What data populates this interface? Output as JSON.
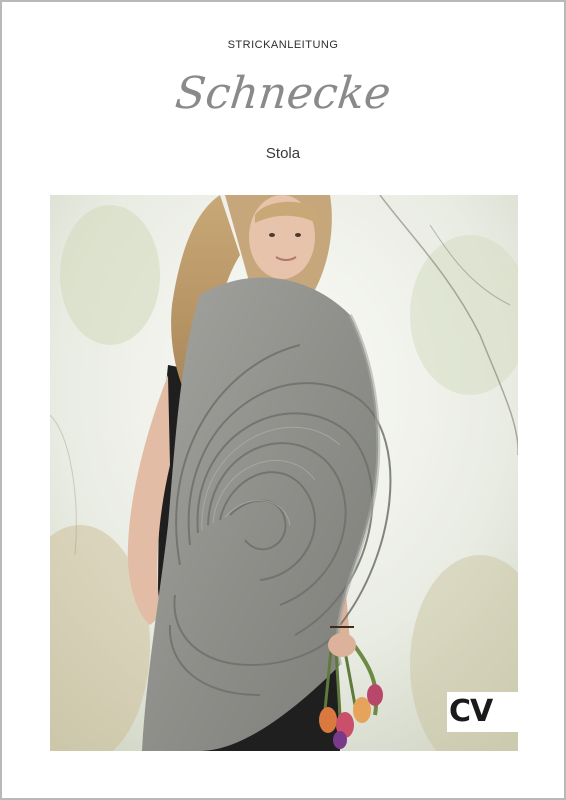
{
  "header": {
    "kicker": "STRICKANLEITUNG",
    "title": "Schnecke",
    "subtitle": "Stola"
  },
  "logo": {
    "text": "CV"
  },
  "colors": {
    "title": "#8a8a8a",
    "text": "#2e2e2e",
    "border": "#b9b9b9",
    "stole": "#8f908c",
    "dress": "#1e1e1e"
  }
}
